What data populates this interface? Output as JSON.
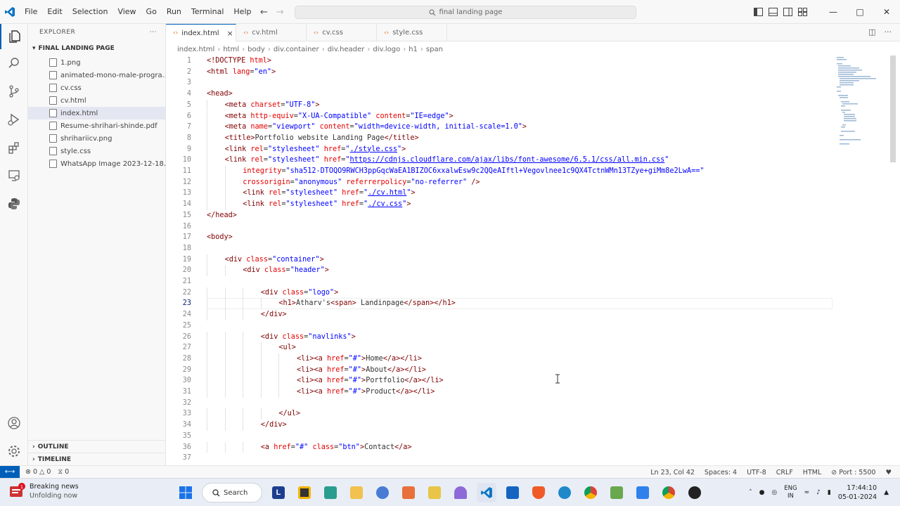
{
  "titlebar": {
    "menu": [
      "File",
      "Edit",
      "Selection",
      "View",
      "Go",
      "Run",
      "Terminal",
      "Help"
    ],
    "command_center": "final landing page",
    "colors": {
      "accent": "#005fb8"
    }
  },
  "sidebar": {
    "title": "EXPLORER",
    "more": "···",
    "folder": "FINAL LANDING PAGE",
    "files": [
      {
        "name": "1.png",
        "selected": false
      },
      {
        "name": "animated-mono-male-progra...",
        "selected": false
      },
      {
        "name": "cv.css",
        "selected": false
      },
      {
        "name": "cv.html",
        "selected": false
      },
      {
        "name": "index.html",
        "selected": true
      },
      {
        "name": "Resume-shrihari-shinde.pdf",
        "selected": false
      },
      {
        "name": "shrihariicv.png",
        "selected": false
      },
      {
        "name": "style.css",
        "selected": false
      },
      {
        "name": "WhatsApp Image 2023-12-18...",
        "selected": false
      }
    ],
    "outline": "OUTLINE",
    "timeline": "TIMELINE"
  },
  "tabs": [
    {
      "label": "index.html",
      "active": true
    },
    {
      "label": "cv.html",
      "active": false
    },
    {
      "label": "cv.css",
      "active": false
    },
    {
      "label": "style.css",
      "active": false
    }
  ],
  "breadcrumb": [
    "index.html",
    "html",
    "body",
    "div.container",
    "div.header",
    "div.logo",
    "h1",
    "span"
  ],
  "editor": {
    "current_line": 23,
    "lines": [
      {
        "n": "1",
        "html": "<span class='tg'>&lt;!DOCTYPE</span> <span class='at'>html</span><span class='tg'>&gt;</span>",
        "indent": 0
      },
      {
        "n": "2",
        "html": "<span class='tg'>&lt;html</span> <span class='at'>lang</span>=<span class='st'>\"en\"</span><span class='tg'>&gt;</span>",
        "indent": 0
      },
      {
        "n": "3",
        "html": "",
        "indent": 0
      },
      {
        "n": "4",
        "html": "<span class='tg'>&lt;head&gt;</span>",
        "indent": 0
      },
      {
        "n": "5",
        "html": "<span class='tg'>&lt;meta</span> <span class='at'>charset</span>=<span class='st'>\"UTF-8\"</span><span class='tg'>&gt;</span>",
        "indent": 1
      },
      {
        "n": "6",
        "html": "<span class='tg'>&lt;meta</span> <span class='at'>http-equiv</span>=<span class='st'>\"X-UA-Compatible\"</span> <span class='at'>content</span>=<span class='st'>\"IE=edge\"</span><span class='tg'>&gt;</span>",
        "indent": 1
      },
      {
        "n": "7",
        "html": "<span class='tg'>&lt;meta</span> <span class='at'>name</span>=<span class='st'>\"viewport\"</span> <span class='at'>content</span>=<span class='st'>\"width=device-width, initial-scale=1.0\"</span><span class='tg'>&gt;</span>",
        "indent": 1
      },
      {
        "n": "8",
        "html": "<span class='tg'>&lt;title&gt;</span>Portfolio website Landing Page<span class='tg'>&lt;/title&gt;</span>",
        "indent": 1
      },
      {
        "n": "9",
        "html": "<span class='tg'>&lt;link</span> <span class='at'>rel</span>=<span class='st'>\"stylesheet\"</span> <span class='at'>href</span>=<span class='st'>\"<span class='ul'>./style.css</span>\"</span><span class='tg'>&gt;</span>",
        "indent": 1
      },
      {
        "n": "10",
        "html": "<span class='tg'>&lt;link</span> <span class='at'>rel</span>=<span class='st'>\"stylesheet\"</span> <span class='at'>href</span>=<span class='st'>\"<span class='ul'>https://cdnjs.cloudflare.com/ajax/libs/font-awesome/6.5.1/css/all.min.css</span>\"</span>",
        "indent": 1
      },
      {
        "n": "11",
        "html": "<span class='at'>integrity</span>=<span class='st'>\"sha512-DTOQO9RWCH3ppGqcWaEA1BIZOC6xxalwEsw9c2QQeAIftl+Vegovlnee1c9QX4TctnWMn13TZye+giMm8e2LwA==\"</span>",
        "indent": 2
      },
      {
        "n": "12",
        "html": "<span class='at'>crossorigin</span>=<span class='st'>\"anonymous\"</span> <span class='at'>referrerpolicy</span>=<span class='st'>\"no-referrer\"</span> <span class='tg'>/&gt;</span>",
        "indent": 2
      },
      {
        "n": "13",
        "html": "<span class='tg'>&lt;link</span> <span class='at'>rel</span>=<span class='st'>\"stylesheet\"</span> <span class='at'>href</span>=<span class='st'>\"<span class='ul'>./cv.html</span>\"</span><span class='tg'>&gt;</span>",
        "indent": 2
      },
      {
        "n": "14",
        "html": "<span class='tg'>&lt;link</span> <span class='at'>rel</span>=<span class='st'>\"stylesheet\"</span> <span class='at'>href</span>=<span class='st'>\"<span class='ul'>./cv.css</span>\"</span><span class='tg'>&gt;</span>",
        "indent": 2
      },
      {
        "n": "15",
        "html": "<span class='tg'>&lt;/head&gt;</span>",
        "indent": 0
      },
      {
        "n": "16",
        "html": "",
        "indent": 0
      },
      {
        "n": "17",
        "html": "<span class='tg'>&lt;body&gt;</span>",
        "indent": 0
      },
      {
        "n": "18",
        "html": "",
        "indent": 0
      },
      {
        "n": "19",
        "html": "<span class='tg'>&lt;div</span> <span class='at'>class</span>=<span class='st'>\"container\"</span><span class='tg'>&gt;</span>",
        "indent": 1
      },
      {
        "n": "20",
        "html": "<span class='tg'>&lt;div</span> <span class='at'>class</span>=<span class='st'>\"header\"</span><span class='tg'>&gt;</span>",
        "indent": 2
      },
      {
        "n": "21",
        "html": "",
        "indent": 0
      },
      {
        "n": "22",
        "html": "<span class='tg'>&lt;div</span> <span class='at'>class</span>=<span class='st'>\"logo\"</span><span class='tg'>&gt;</span>",
        "indent": 3
      },
      {
        "n": "23",
        "html": "<span class='tg'>&lt;h1&gt;</span>Atharv's<span class='tg'>&lt;span&gt;</span> Landinpage<span class='tg'>&lt;/span&gt;&lt;/h1&gt;</span>",
        "indent": 4
      },
      {
        "n": "24",
        "html": "<span class='tg'>&lt;/div&gt;</span>",
        "indent": 3
      },
      {
        "n": "25",
        "html": "",
        "indent": 0
      },
      {
        "n": "26",
        "html": "<span class='tg'>&lt;div</span> <span class='at'>class</span>=<span class='st'>\"navlinks\"</span><span class='tg'>&gt;</span>",
        "indent": 3
      },
      {
        "n": "27",
        "html": "<span class='tg'>&lt;ul&gt;</span>",
        "indent": 4
      },
      {
        "n": "28",
        "html": "<span class='tg'>&lt;li&gt;&lt;a</span> <span class='at'>href</span>=<span class='st'>\"#\"</span><span class='tg'>&gt;</span>Home<span class='tg'>&lt;/a&gt;&lt;/li&gt;</span>",
        "indent": 5
      },
      {
        "n": "29",
        "html": "<span class='tg'>&lt;li&gt;&lt;a</span> <span class='at'>href</span>=<span class='st'>\"#\"</span><span class='tg'>&gt;</span>About<span class='tg'>&lt;/a&gt;&lt;/li&gt;</span>",
        "indent": 5
      },
      {
        "n": "30",
        "html": "<span class='tg'>&lt;li&gt;&lt;a</span> <span class='at'>href</span>=<span class='st'>\"#\"</span><span class='tg'>&gt;</span>Portfolio<span class='tg'>&lt;/a&gt;&lt;/li&gt;</span>",
        "indent": 5
      },
      {
        "n": "31",
        "html": "<span class='tg'>&lt;li&gt;&lt;a</span> <span class='at'>href</span>=<span class='st'>\"#\"</span><span class='tg'>&gt;</span>Product<span class='tg'>&lt;/a&gt;&lt;/li&gt;</span>",
        "indent": 5
      },
      {
        "n": "32",
        "html": "",
        "indent": 0
      },
      {
        "n": "33",
        "html": "<span class='tg'>&lt;/ul&gt;</span>",
        "indent": 4
      },
      {
        "n": "34",
        "html": "<span class='tg'>&lt;/div&gt;</span>",
        "indent": 3
      },
      {
        "n": "35",
        "html": "",
        "indent": 0
      },
      {
        "n": "36",
        "html": "<span class='tg'>&lt;a</span> <span class='at'>href</span>=<span class='st'>\"#\"</span> <span class='at'>class</span>=<span class='st'>\"btn\"</span><span class='tg'>&gt;</span>Contact<span class='tg'>&lt;/a&gt;</span>",
        "indent": 3
      },
      {
        "n": "37",
        "html": "",
        "indent": 0
      }
    ]
  },
  "statusbar": {
    "errors": "0",
    "warnings": "0",
    "ports": "0",
    "position": "Ln 23, Col 42",
    "spaces": "Spaces: 4",
    "encoding": "UTF-8",
    "eol": "CRLF",
    "language": "HTML",
    "port": "Port : 5500"
  },
  "taskbar": {
    "news_title": "Breaking news",
    "news_sub": "Unfolding now",
    "search": "Search",
    "lang_top": "ENG",
    "lang_bottom": "IN",
    "time": "17:44:10",
    "date": "05-01-2024"
  }
}
